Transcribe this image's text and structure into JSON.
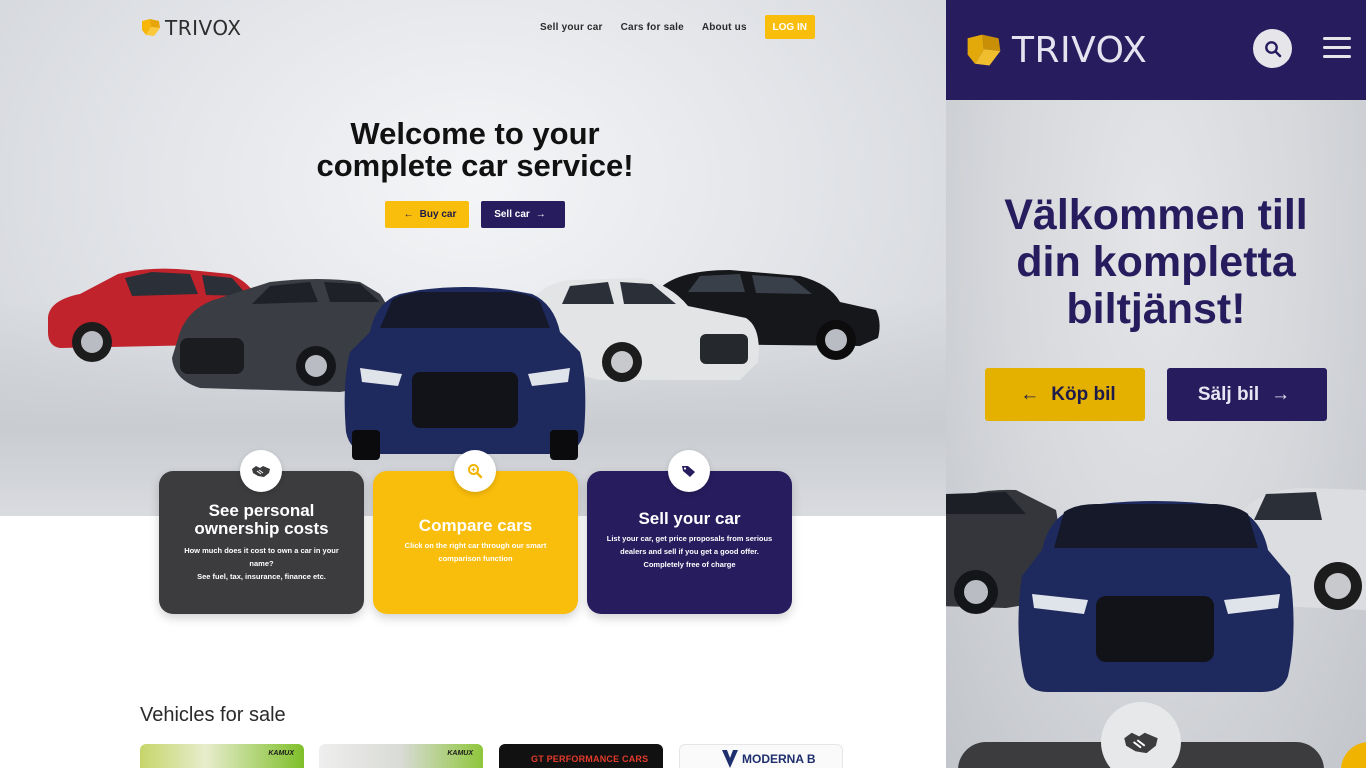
{
  "desktop": {
    "logo_text": "TRIVOX",
    "nav": {
      "items": [
        "Sell your car",
        "Cars for sale",
        "About us"
      ],
      "login_label": "LOG IN"
    },
    "hero": {
      "title": "Welcome to your complete car service!",
      "buy_label": "Buy car",
      "sell_label": "Sell car"
    },
    "cards": [
      {
        "title": "See personal ownership costs",
        "body_lines": [
          "How much does it cost to own a car in your name?",
          "See fuel, tax, insurance, finance etc."
        ],
        "icon": "handshake-icon"
      },
      {
        "title": "Compare cars",
        "body_lines": [
          "Click on the right car through our smart comparison function"
        ],
        "icon": "magnifier-icon"
      },
      {
        "title": "Sell your car",
        "body_lines": [
          "List your car, get price proposals from serious dealers and sell if you get a good offer. Completely free of charge"
        ],
        "icon": "tags-icon"
      }
    ],
    "vehicles": {
      "title": "Vehicles for sale",
      "dealers": [
        "KAMUX",
        "KAMUX",
        "GT PERFORMANCE CARS",
        "MODERNA B"
      ]
    }
  },
  "mobile": {
    "logo_text": "TRIVOX",
    "title": "Välkommen till din kompletta biltjänst!",
    "buy_label": "Köp bil",
    "sell_label": "Sälj bil"
  },
  "colors": {
    "brand_yellow": "#f9bd0b",
    "brand_purple": "#271c5e",
    "card_dark": "#3c3c3e"
  }
}
